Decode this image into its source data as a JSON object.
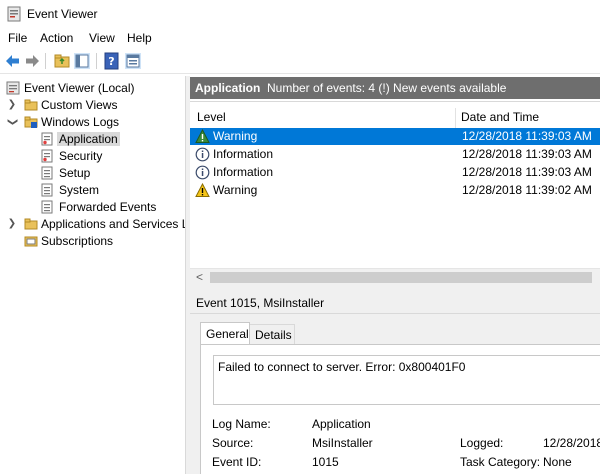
{
  "window": {
    "title": "Event Viewer"
  },
  "menu": [
    "File",
    "Action",
    "View",
    "Help"
  ],
  "toolbar": {
    "icons": [
      "back-arrow-icon",
      "forward-arrow-icon",
      "folder-up-icon",
      "show-hide-tree-icon",
      "help-icon",
      "properties-icon"
    ]
  },
  "tree": {
    "root": "Event Viewer (Local)",
    "custom_views": "Custom Views",
    "windows_logs": "Windows Logs",
    "logs": [
      "Application",
      "Security",
      "Setup",
      "System",
      "Forwarded Events"
    ],
    "apps_services": "Applications and Services Lo",
    "subscriptions": "Subscriptions",
    "selected": "Application"
  },
  "pane": {
    "name": "Application",
    "info": "Number of events: 4 (!) New events available"
  },
  "grid": {
    "columns": [
      "Level",
      "Date and Time"
    ],
    "rows": [
      {
        "level": "Warning",
        "datetime": "12/28/2018 11:39:03 AM",
        "icon": "warning-icon",
        "selected": true
      },
      {
        "level": "Information",
        "datetime": "12/28/2018 11:39:03 AM",
        "icon": "information-icon",
        "selected": false
      },
      {
        "level": "Information",
        "datetime": "12/28/2018 11:39:03 AM",
        "icon": "information-icon",
        "selected": false
      },
      {
        "level": "Warning",
        "datetime": "12/28/2018 11:39:02 AM",
        "icon": "warning-icon",
        "selected": false
      }
    ]
  },
  "detail": {
    "title": "Event 1015, MsiInstaller",
    "tabs": [
      "General",
      "Details"
    ],
    "active_tab": "General",
    "message": "Failed to connect to server. Error: 0x800401F0",
    "fields": {
      "log_name_label": "Log Name:",
      "log_name": "Application",
      "source_label": "Source:",
      "source": "MsiInstaller",
      "logged_label": "Logged:",
      "logged": "12/28/2018",
      "event_id_label": "Event ID:",
      "event_id": "1015",
      "task_category_label": "Task Category:",
      "task_category": "None"
    }
  },
  "colors": {
    "selection": "#0078d7",
    "header_bar": "#6e6e6e",
    "tree_selection": "#d9d9d9",
    "panel_bg": "#f0f0f0"
  }
}
